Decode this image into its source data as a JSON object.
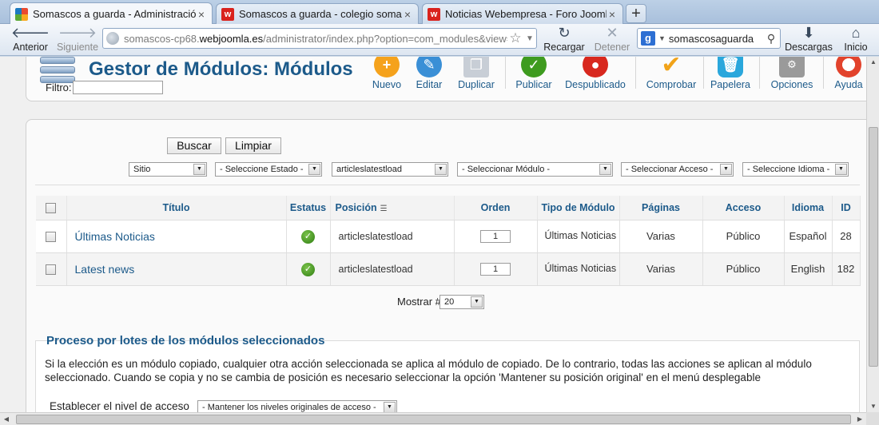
{
  "browser": {
    "tabs": [
      {
        "label": "Somascos a guarda - Administración ...",
        "favicon": "joomla-icon",
        "active": true
      },
      {
        "label": "Somascos a guarda - colegio somasc...",
        "favicon": "webempresa-icon",
        "active": false
      },
      {
        "label": "Noticias Webempresa - Foro Joomla!...",
        "favicon": "webempresa-icon",
        "active": false
      }
    ],
    "new_tab": "+",
    "back_label": "Anterior",
    "forward_label": "Siguiente",
    "url_prefix": "somascos-cp68.",
    "url_domain": "webjoomla.es",
    "url_path": "/administrator/index.php?option=com_modules&view=m",
    "reload_label": "Recargar",
    "stop_label": "Detener",
    "search_engine": "g",
    "search_value": "somascosaguarda",
    "downloads_label": "Descargas",
    "home_label": "Inicio"
  },
  "toolbar": {
    "title": "Gestor de Módulos: Módulos",
    "buttons": [
      {
        "label": "Nuevo",
        "icon": "plus-icon",
        "color": "#f5a21c"
      },
      {
        "label": "Editar",
        "icon": "pencil-icon",
        "color": "#3a8fd6"
      },
      {
        "label": "Duplicar",
        "icon": "copy-icon",
        "color": "#b5bcc5"
      },
      {
        "label": "Publicar",
        "icon": "check-icon",
        "color": "#3e9b1f"
      },
      {
        "label": "Despublicado",
        "icon": "stop-icon",
        "color": "#d8281e"
      },
      {
        "label": "Comprobar",
        "icon": "checkmark-icon",
        "color": "#f1a319"
      },
      {
        "label": "Papelera",
        "icon": "trash-icon",
        "color": "#2aa7dc"
      },
      {
        "label": "Opciones",
        "icon": "options-icon",
        "color": "#8a8a8a"
      },
      {
        "label": "Ayuda",
        "icon": "lifebuoy-icon",
        "color": "#e2432c"
      }
    ]
  },
  "filters": {
    "filter_label": "Filtro:",
    "filter_value": "",
    "search_button": "Buscar",
    "clear_button": "Limpiar",
    "selects": [
      {
        "name": "client",
        "value": "Sitio"
      },
      {
        "name": "state",
        "value": "- Seleccione Estado -"
      },
      {
        "name": "position",
        "value": "articleslatestload"
      },
      {
        "name": "module",
        "value": "- Seleccionar Módulo -"
      },
      {
        "name": "access",
        "value": "- Seleccionar Acceso -"
      },
      {
        "name": "language",
        "value": "- Seleccione Idioma -"
      }
    ]
  },
  "table": {
    "headers": [
      "Título",
      "Estatus",
      "Posición",
      "Orden",
      "Tipo de Módulo",
      "Páginas",
      "Acceso",
      "Idioma",
      "ID"
    ],
    "rows": [
      {
        "title": "Últimas Noticias",
        "status": "published",
        "position": "articleslatestload",
        "order": "1",
        "type": "Últimas Noticias",
        "pages": "Varias",
        "access": "Público",
        "language": "Español",
        "id": "28"
      },
      {
        "title": "Latest news",
        "status": "published",
        "position": "articleslatestload",
        "order": "1",
        "type": "Últimas Noticias",
        "pages": "Varias",
        "access": "Público",
        "language": "English",
        "id": "182"
      }
    ]
  },
  "pagination": {
    "label": "Mostrar #",
    "value": "20"
  },
  "batch": {
    "title": "Proceso por lotes de los módulos seleccionados",
    "description": "Si la elección es un módulo copiado, cualquier otra acción seleccionada se aplica al módulo de copiado. De lo contrario, todas las acciones se aplican al módulo seleccionado. Cuando se copia y no se cambia de posición es necesario seleccionar la opción 'Mantener su posición original' en el menú desplegable",
    "access_label": "Establecer el nivel de acceso",
    "access_select": "- Mantener los niveles originales de acceso -"
  }
}
